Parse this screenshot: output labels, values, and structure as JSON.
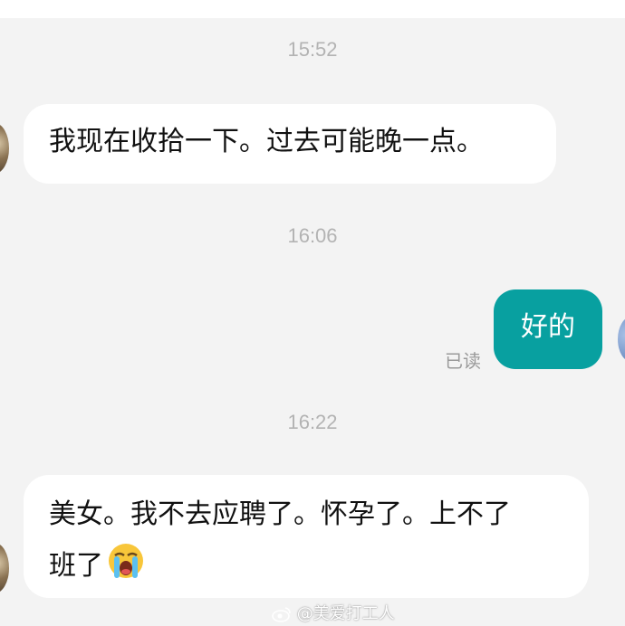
{
  "messages": [
    {
      "type": "timestamp",
      "text": "15:52"
    },
    {
      "type": "incoming",
      "text": "我现在收拾一下。过去可能晚一点。"
    },
    {
      "type": "timestamp",
      "text": "16:06"
    },
    {
      "type": "outgoing",
      "text": "好的",
      "status": "已读"
    },
    {
      "type": "timestamp",
      "text": "16:22"
    },
    {
      "type": "incoming",
      "line1": "美女。我不去应聘了。怀孕了。上不了",
      "line2": "班了",
      "emoji": "loudly-crying-face"
    }
  ],
  "watermark": {
    "icon": "weibo-icon",
    "text": "@美爱打工人"
  },
  "colors": {
    "outgoing_bubble": "#08a0a0",
    "background": "#f3f3f3",
    "incoming_bubble": "#ffffff"
  }
}
